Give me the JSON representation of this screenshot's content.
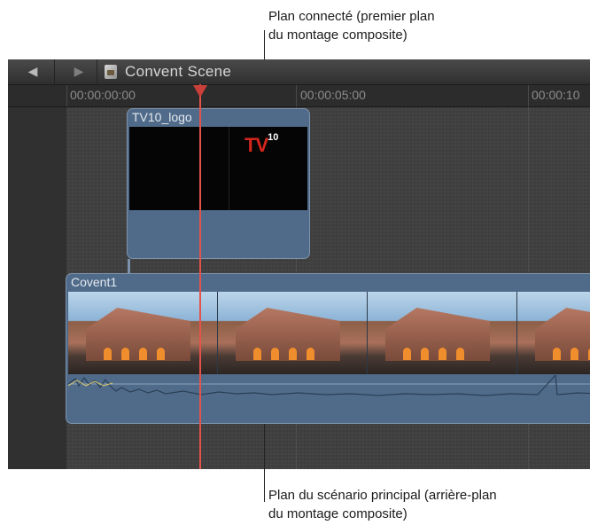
{
  "callouts": {
    "connected": {
      "line1": "Plan connecté (premier plan",
      "line2": "du montage composite)"
    },
    "primary": {
      "line1": "Plan du scénario principal (arrière-plan",
      "line2": "du montage composite)"
    }
  },
  "toolbar": {
    "back_icon": "back-arrow-icon",
    "back_glyph": "◀",
    "forward_icon": "forward-arrow-icon",
    "forward_glyph": "▶",
    "project_icon": "project-clapper-icon",
    "project_title": "Convent Scene"
  },
  "ruler": {
    "timecodes": [
      "00:00:00:00",
      "00:00:05:00",
      "00:00:10"
    ]
  },
  "clips": {
    "connected": {
      "name": "TV10_logo",
      "logo_text": "TV",
      "logo_number": "10"
    },
    "primary": {
      "name": "Covent1"
    }
  },
  "colors": {
    "clip_blue": "#506b8a",
    "playhead_red": "#e4524c",
    "logo_red": "#d4261c"
  }
}
